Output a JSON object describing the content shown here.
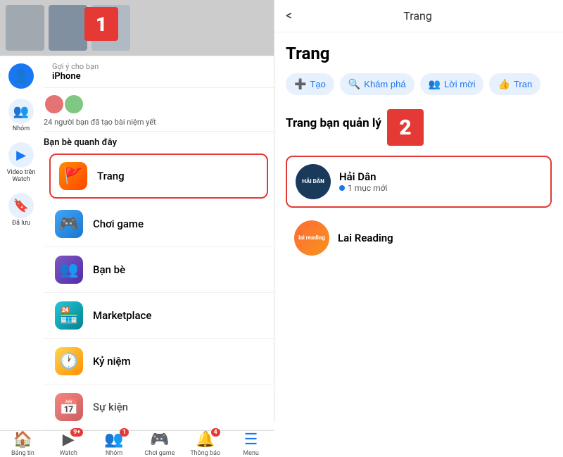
{
  "left": {
    "step1_label": "1",
    "profile": {
      "suggestion_label": "Gợi ý cho bạn",
      "name": "iPhone"
    },
    "friends_count": "24 người bạn đã tạo bài niệm yết",
    "nearby_label": "Bạn bè quanh đây",
    "menu_items": [
      {
        "id": "trang",
        "label": "Trang",
        "icon": "🚩",
        "icon_class": "icon-orange",
        "highlighted": true
      },
      {
        "id": "choi-game",
        "label": "Chơi game",
        "icon": "🎮",
        "icon_class": "icon-blue",
        "highlighted": false
      },
      {
        "id": "ban-be",
        "label": "Bạn bè",
        "icon": "👥",
        "icon_class": "icon-purple",
        "highlighted": false
      },
      {
        "id": "marketplace",
        "label": "Marketplace",
        "icon": "🏪",
        "icon_class": "icon-teal",
        "highlighted": false
      },
      {
        "id": "ky-niem",
        "label": "Kỷ niệm",
        "icon": "🕐",
        "icon_class": "icon-yellow",
        "highlighted": false
      },
      {
        "id": "su-kien",
        "label": "Sự kiện",
        "icon": "📅",
        "icon_class": "icon-red",
        "highlighted": false
      }
    ],
    "sidebar_items": [
      {
        "id": "nhom",
        "icon": "👥",
        "label": "Nhóm"
      },
      {
        "id": "video",
        "icon": "▶",
        "label": "Video trên Watch"
      },
      {
        "id": "da-luu",
        "icon": "🔖",
        "label": "Đã lưu"
      }
    ],
    "bottom_nav": [
      {
        "id": "bang-tin",
        "icon": "🏠",
        "label": "Bảng tin",
        "badge": null,
        "active": false
      },
      {
        "id": "watch",
        "icon": "▶",
        "label": "Watch",
        "badge": "9+",
        "active": false
      },
      {
        "id": "nhom",
        "icon": "👥",
        "label": "Nhóm",
        "badge": "1",
        "active": false
      },
      {
        "id": "choi-game",
        "icon": "🎮",
        "label": "Chơi game",
        "badge": null,
        "active": false
      },
      {
        "id": "thong-bao",
        "icon": "🔔",
        "label": "Thông báo",
        "badge": "4",
        "active": false
      },
      {
        "id": "menu",
        "icon": "☰",
        "label": "Menu",
        "badge": null,
        "active": true
      }
    ]
  },
  "right": {
    "back_label": "<",
    "header_title": "Trang",
    "page_title": "Trang",
    "tabs": [
      {
        "id": "tao",
        "icon": "➕",
        "label": "Tạo"
      },
      {
        "id": "kham-pha",
        "icon": "🔍",
        "label": "Khám phá"
      },
      {
        "id": "loi-moi",
        "icon": "👥",
        "label": "Lời mời"
      },
      {
        "id": "tran",
        "icon": "👍",
        "label": "Tran"
      }
    ],
    "section_title": "Trang bạn quản lý",
    "step2_label": "2",
    "pages": [
      {
        "id": "hai-dan",
        "name": "Hải Dân",
        "sub": "1 mục mới",
        "logo_text": "HẢI DÂN",
        "logo_class": "logo-dark",
        "highlighted": true,
        "has_dot": true
      },
      {
        "id": "lai-reading",
        "name": "Lai Reading",
        "sub": "",
        "logo_text": "lai reading",
        "logo_class": "logo-orange",
        "highlighted": false,
        "has_dot": false
      }
    ]
  }
}
